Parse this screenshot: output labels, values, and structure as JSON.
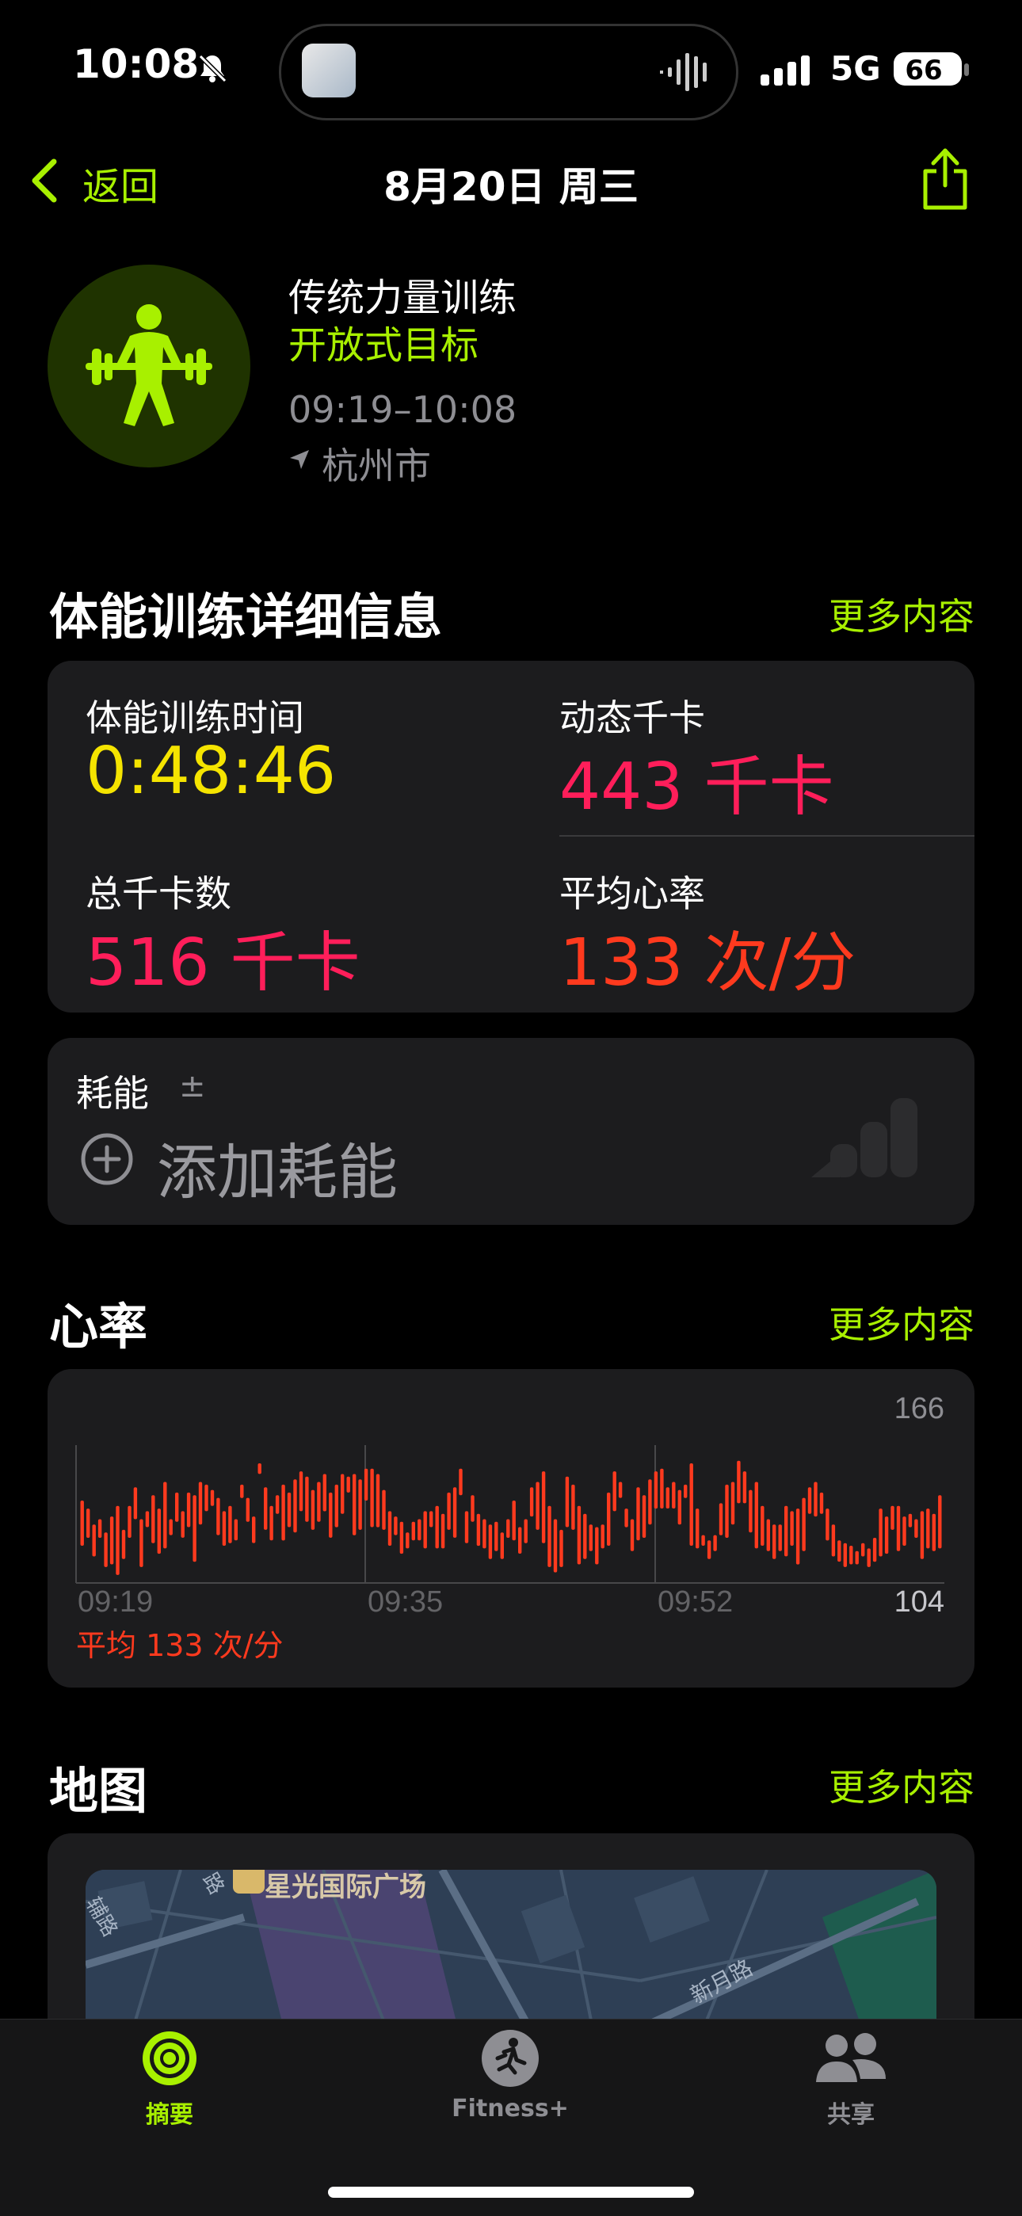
{
  "status_bar": {
    "time": "10:08",
    "network": "5G",
    "battery": "66"
  },
  "nav": {
    "back_label": "返回",
    "title": "8月20日 周三"
  },
  "workout": {
    "type": "传统力量训练",
    "goal": "开放式目标",
    "time_range": "09:19–10:08",
    "location": "杭州市"
  },
  "details": {
    "title": "体能训练详细信息",
    "more": "更多内容",
    "workout_time_label": "体能训练时间",
    "workout_time_value": "0:48:46",
    "active_cal_label": "动态千卡",
    "active_cal_value": "443 千卡",
    "total_cal_label": "总千卡数",
    "total_cal_value": "516 千卡",
    "avg_hr_label": "平均心率",
    "avg_hr_value": "133 次/分"
  },
  "effort": {
    "label": "耗能",
    "plus_minus": "±",
    "add_label": "添加耗能"
  },
  "heart_rate": {
    "title": "心率",
    "more": "更多内容",
    "avg_label": "平均 133 次/分"
  },
  "map": {
    "title": "地图",
    "more": "更多内容",
    "poi_label": "星光国际广场",
    "road_label_1": "新月路",
    "road_label_2": "辅路",
    "road_label_3": "路"
  },
  "tabbar": {
    "tab1": "摘要",
    "tab2": "Fitness+",
    "tab3": "共享"
  },
  "colors": {
    "accent_green": "#a8f000",
    "yellow": "#f5e400",
    "pink": "#ff1e5a",
    "red_orange": "#ff3a1e",
    "card_bg": "#1c1c1e"
  },
  "chart_data": {
    "type": "bar",
    "title": "",
    "ylim": [
      104,
      166
    ],
    "y_tick_labels": [
      "166",
      "104"
    ],
    "x_tick_labels": [
      "09:19",
      "09:35",
      "09:52"
    ],
    "series": [
      {
        "name": "",
        "color": "#ff3a1e",
        "ranges": [
          [
            118,
            135
          ],
          [
            121,
            132
          ],
          [
            114,
            126
          ],
          [
            121,
            128
          ],
          [
            110,
            123
          ],
          [
            111,
            129
          ],
          [
            107,
            133
          ],
          [
            113,
            124
          ],
          [
            121,
            133
          ],
          [
            128,
            140
          ],
          [
            110,
            128
          ],
          [
            125,
            131
          ],
          [
            119,
            137
          ],
          [
            115,
            132
          ],
          [
            117,
            142
          ],
          [
            122,
            128
          ],
          [
            127,
            138
          ],
          [
            121,
            131
          ],
          [
            125,
            138
          ],
          [
            112,
            137
          ],
          [
            126,
            142
          ],
          [
            131,
            141
          ],
          [
            133,
            139
          ],
          [
            122,
            136
          ],
          [
            118,
            131
          ],
          [
            119,
            133
          ],
          [
            120,
            128
          ],
          [
            136,
            141
          ],
          [
            127,
            136
          ],
          [
            119,
            129
          ],
          [
            145,
            149
          ],
          [
            124,
            140
          ],
          [
            120,
            133
          ],
          [
            130,
            137
          ],
          [
            120,
            141
          ],
          [
            125,
            138
          ],
          [
            123,
            143
          ],
          [
            131,
            146
          ],
          [
            127,
            144
          ],
          [
            124,
            139
          ],
          [
            127,
            142
          ],
          [
            131,
            145
          ],
          [
            121,
            138
          ],
          [
            125,
            141
          ],
          [
            130,
            145
          ],
          [
            138,
            144
          ],
          [
            122,
            145
          ],
          [
            124,
            143
          ],
          [
            135,
            147
          ],
          [
            125,
            147
          ],
          [
            125,
            145
          ],
          [
            124,
            139
          ],
          [
            118,
            131
          ],
          [
            122,
            129
          ],
          [
            115,
            127
          ],
          [
            117,
            123
          ],
          [
            120,
            127
          ],
          [
            120,
            128
          ],
          [
            117,
            131
          ],
          [
            125,
            131
          ],
          [
            117,
            133
          ],
          [
            117,
            130
          ],
          [
            124,
            138
          ],
          [
            121,
            140
          ],
          [
            137,
            147
          ],
          [
            119,
            131
          ],
          [
            127,
            137
          ],
          [
            118,
            130
          ],
          [
            117,
            128
          ],
          [
            113,
            126
          ],
          [
            116,
            127
          ],
          [
            113,
            123
          ],
          [
            121,
            128
          ],
          [
            120,
            135
          ],
          [
            115,
            125
          ],
          [
            119,
            128
          ],
          [
            129,
            140
          ],
          [
            124,
            142
          ],
          [
            119,
            146
          ],
          [
            110,
            133
          ],
          [
            108,
            128
          ],
          [
            110,
            124
          ],
          [
            125,
            144
          ],
          [
            124,
            141
          ],
          [
            111,
            133
          ],
          [
            113,
            130
          ],
          [
            116,
            126
          ],
          [
            111,
            125
          ],
          [
            117,
            126
          ],
          [
            118,
            138
          ],
          [
            131,
            146
          ],
          [
            136,
            142
          ],
          [
            125,
            132
          ],
          [
            116,
            128
          ],
          [
            120,
            140
          ],
          [
            121,
            137
          ],
          [
            126,
            143
          ],
          [
            132,
            146
          ],
          [
            132,
            147
          ],
          [
            132,
            140
          ],
          [
            132,
            142
          ],
          [
            126,
            139
          ],
          [
            136,
            141
          ],
          [
            118,
            149
          ],
          [
            117,
            132
          ],
          [
            118,
            122
          ],
          [
            113,
            120
          ],
          [
            116,
            122
          ],
          [
            122,
            134
          ],
          [
            121,
            141
          ],
          [
            126,
            142
          ],
          [
            134,
            150
          ],
          [
            134,
            146
          ],
          [
            123,
            139
          ],
          [
            117,
            142
          ],
          [
            118,
            133
          ],
          [
            116,
            128
          ],
          [
            113,
            126
          ],
          [
            116,
            126
          ],
          [
            114,
            133
          ],
          [
            118,
            131
          ],
          [
            111,
            132
          ],
          [
            116,
            136
          ],
          [
            130,
            140
          ],
          [
            129,
            142
          ],
          [
            130,
            138
          ],
          [
            120,
            132
          ],
          [
            114,
            126
          ],
          [
            112,
            120
          ],
          [
            110,
            119
          ],
          [
            111,
            118
          ],
          [
            111,
            116
          ],
          [
            114,
            119
          ],
          [
            110,
            117
          ],
          [
            112,
            121
          ],
          [
            114,
            132
          ],
          [
            115,
            129
          ],
          [
            124,
            133
          ],
          [
            116,
            133
          ],
          [
            118,
            129
          ],
          [
            125,
            130
          ],
          [
            121,
            128
          ],
          [
            113,
            131
          ],
          [
            117,
            132
          ],
          [
            116,
            130
          ],
          [
            117,
            137
          ]
        ]
      }
    ]
  }
}
